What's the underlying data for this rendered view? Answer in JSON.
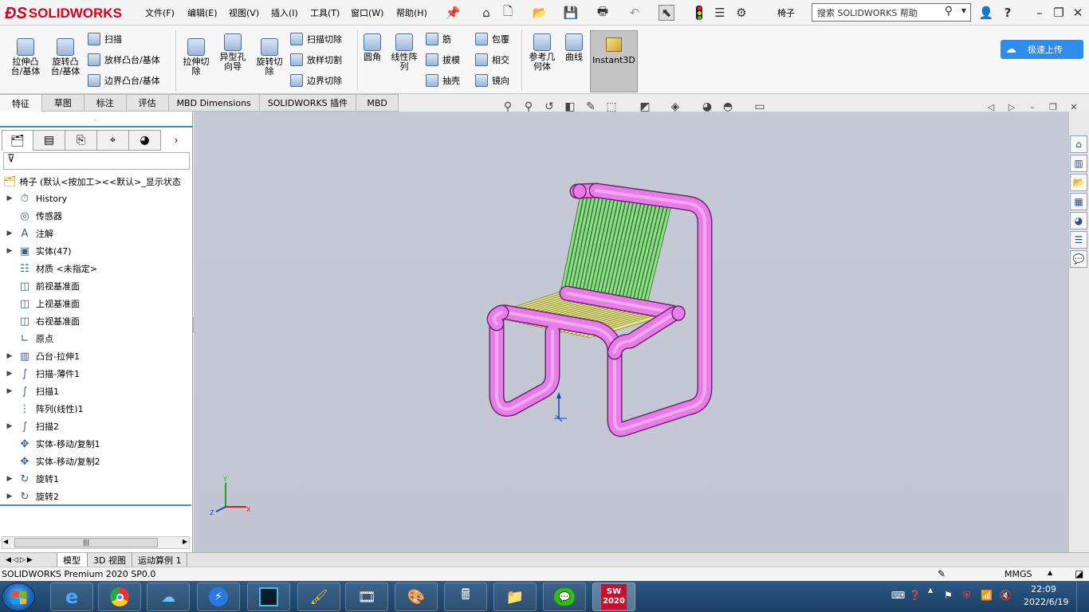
{
  "app": {
    "brand": "SOLIDWORKS",
    "document": "椅子"
  },
  "menu": [
    "文件(F)",
    "编辑(E)",
    "视图(V)",
    "插入(I)",
    "工具(T)",
    "窗口(W)",
    "帮助(H)"
  ],
  "search": {
    "placeholder": "搜索 SOLIDWORKS 帮助"
  },
  "ribbon": {
    "big": [
      {
        "label": "拉伸凸\n台/基体"
      },
      {
        "label": "旋转凸\n台/基体"
      },
      {
        "label": "拉伸切\n除"
      },
      {
        "label": "异型孔\n向导"
      },
      {
        "label": "旋转切\n除"
      },
      {
        "label": "圆角"
      },
      {
        "label": "线性阵\n列"
      },
      {
        "label": "参考几\n何体"
      },
      {
        "label": "曲线"
      }
    ],
    "small": [
      "扫描",
      "放样凸台/基体",
      "边界凸台/基体",
      "扫描切除",
      "放样切割",
      "边界切除",
      "筋",
      "拔模",
      "抽壳",
      "包覆",
      "相交",
      "镜向"
    ],
    "instant3d": "Instant3D",
    "upload": "极速上传"
  },
  "tabs": [
    "特征",
    "草图",
    "标注",
    "评估",
    "MBD Dimensions",
    "SOLIDWORKS 插件",
    "MBD"
  ],
  "tree": {
    "root": "椅子 (默认<按加工><<默认>_显示状态",
    "items": [
      {
        "label": "History",
        "expandable": true,
        "icon": "history-icon"
      },
      {
        "label": "传感器",
        "expandable": false,
        "icon": "sensor-icon"
      },
      {
        "label": "注解",
        "expandable": true,
        "icon": "annotation-icon"
      },
      {
        "label": "实体(47)",
        "expandable": true,
        "icon": "solid-bodies-icon"
      },
      {
        "label": "材质 <未指定>",
        "expandable": false,
        "icon": "material-icon"
      },
      {
        "label": "前视基准面",
        "expandable": false,
        "icon": "plane-icon"
      },
      {
        "label": "上视基准面",
        "expandable": false,
        "icon": "plane-icon"
      },
      {
        "label": "右视基准面",
        "expandable": false,
        "icon": "plane-icon"
      },
      {
        "label": "原点",
        "expandable": false,
        "icon": "origin-icon"
      },
      {
        "label": "凸台-拉伸1",
        "expandable": true,
        "icon": "extrude-icon"
      },
      {
        "label": "扫描-薄件1",
        "expandable": true,
        "icon": "sweep-icon"
      },
      {
        "label": "扫描1",
        "expandable": true,
        "icon": "sweep-icon"
      },
      {
        "label": "阵列(线性)1",
        "expandable": false,
        "icon": "linear-pattern-icon"
      },
      {
        "label": "扫描2",
        "expandable": true,
        "icon": "sweep-icon"
      },
      {
        "label": "实体-移动/复制1",
        "expandable": false,
        "icon": "move-copy-icon"
      },
      {
        "label": "实体-移动/复制2",
        "expandable": false,
        "icon": "move-copy-icon"
      },
      {
        "label": "旋转1",
        "expandable": true,
        "icon": "revolve-icon"
      },
      {
        "label": "旋转2",
        "expandable": true,
        "icon": "revolve-icon"
      }
    ]
  },
  "bottom_tabs": [
    "模型",
    "3D 视图",
    "运动算例 1"
  ],
  "status": {
    "left": "SOLIDWORKS Premium 2020 SP0.0",
    "units": "MMGS"
  },
  "clock": {
    "time": "22:09",
    "date": "2022/6/19"
  },
  "taskbar": {
    "sw_label": "2020"
  },
  "triad": {
    "x": "X",
    "y": "Y",
    "z": "Z"
  },
  "colors": {
    "tube": "#e87ce8",
    "seat": "#e6e690",
    "back": "#8fe08a",
    "viewport": "#c4c8d4",
    "brand": "#d8001f"
  }
}
